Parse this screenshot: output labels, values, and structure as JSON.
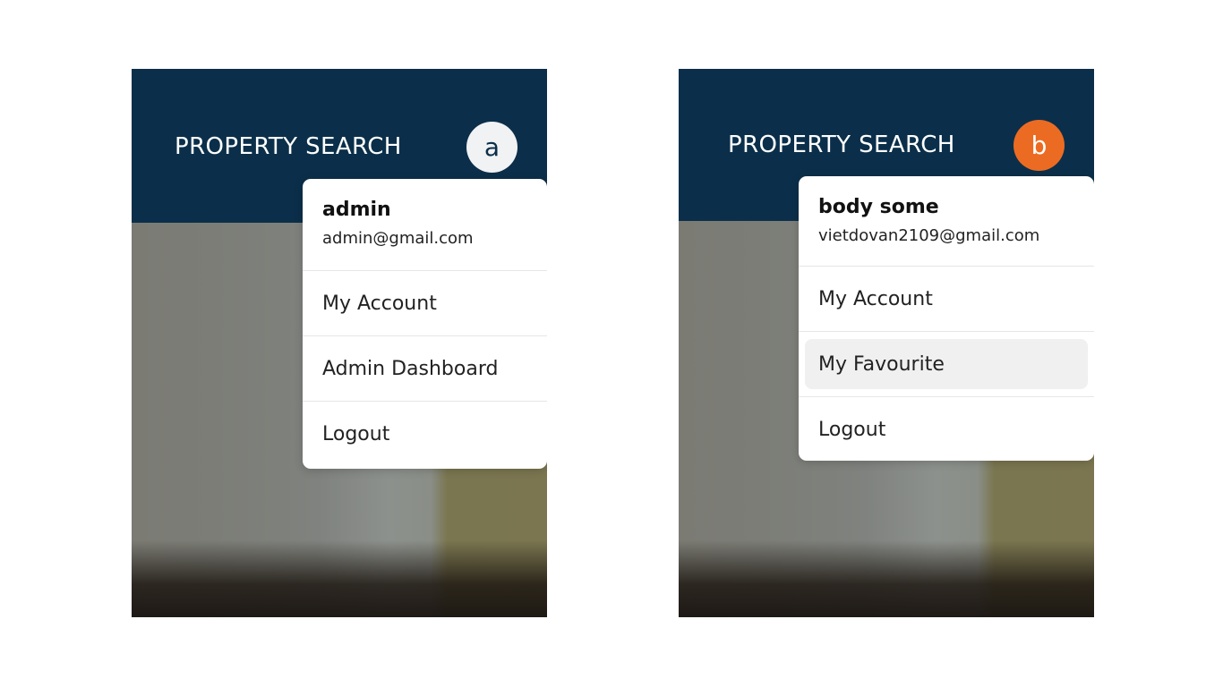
{
  "panels": [
    {
      "brand": "PROPERTY SEARCH",
      "avatar_initial": "a",
      "avatar_color": "#f1f2f4",
      "user": {
        "name": "admin",
        "email": "admin@gmail.com"
      },
      "menu_items": [
        {
          "label": "My Account"
        },
        {
          "label": "Admin Dashboard"
        },
        {
          "label": "Logout"
        }
      ]
    },
    {
      "brand": "PROPERTY SEARCH",
      "avatar_initial": "b",
      "avatar_color": "#ec6b22",
      "user": {
        "name": "body some",
        "email": "vietdovan2109@gmail.com"
      },
      "menu_items": [
        {
          "label": "My Account"
        },
        {
          "label": "My Favourite",
          "highlighted": true
        },
        {
          "label": "Logout"
        }
      ]
    }
  ],
  "colors": {
    "navbar": "#0b2f4a",
    "accent_orange": "#ec6b22"
  }
}
